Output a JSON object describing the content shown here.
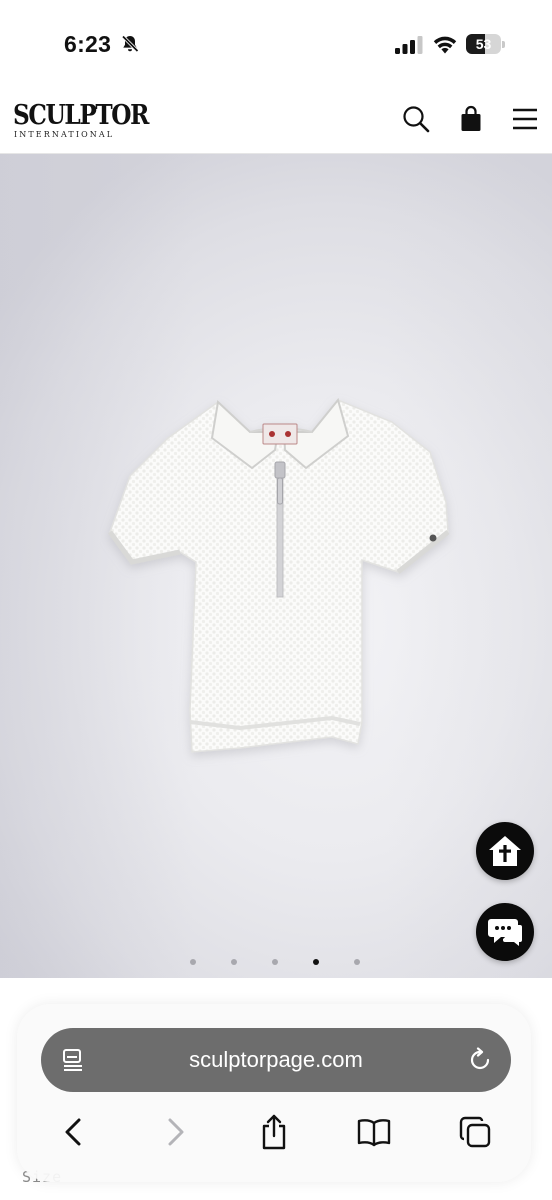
{
  "status_bar": {
    "time": "6:23",
    "battery_level": "53",
    "icons": [
      "bell-slash-icon",
      "cellular-signal-icon",
      "wifi-icon",
      "battery-icon"
    ]
  },
  "site_header": {
    "logo_main": "SCULPTOR",
    "logo_sub": "INTERNATIONAL",
    "icons": [
      "search-icon",
      "shopping-bag-icon",
      "menu-icon"
    ]
  },
  "product": {
    "image_subject": "white knit half-zip polo shirt",
    "carousel": {
      "total": 5,
      "active_index": 3
    }
  },
  "floating_buttons": [
    "home-icon",
    "chat-icon"
  ],
  "page_below": {
    "size_label": "Size"
  },
  "browser": {
    "url": "sculptorpage.com",
    "toolbar": [
      "back-icon",
      "forward-icon",
      "share-icon",
      "bookmarks-icon",
      "tabs-icon"
    ]
  },
  "colors": {
    "fab_background": "#0b0b0b",
    "url_bar": "#6d6d6d",
    "carousel_active": "#111111",
    "carousel_inactive": "#a8a8ae"
  }
}
